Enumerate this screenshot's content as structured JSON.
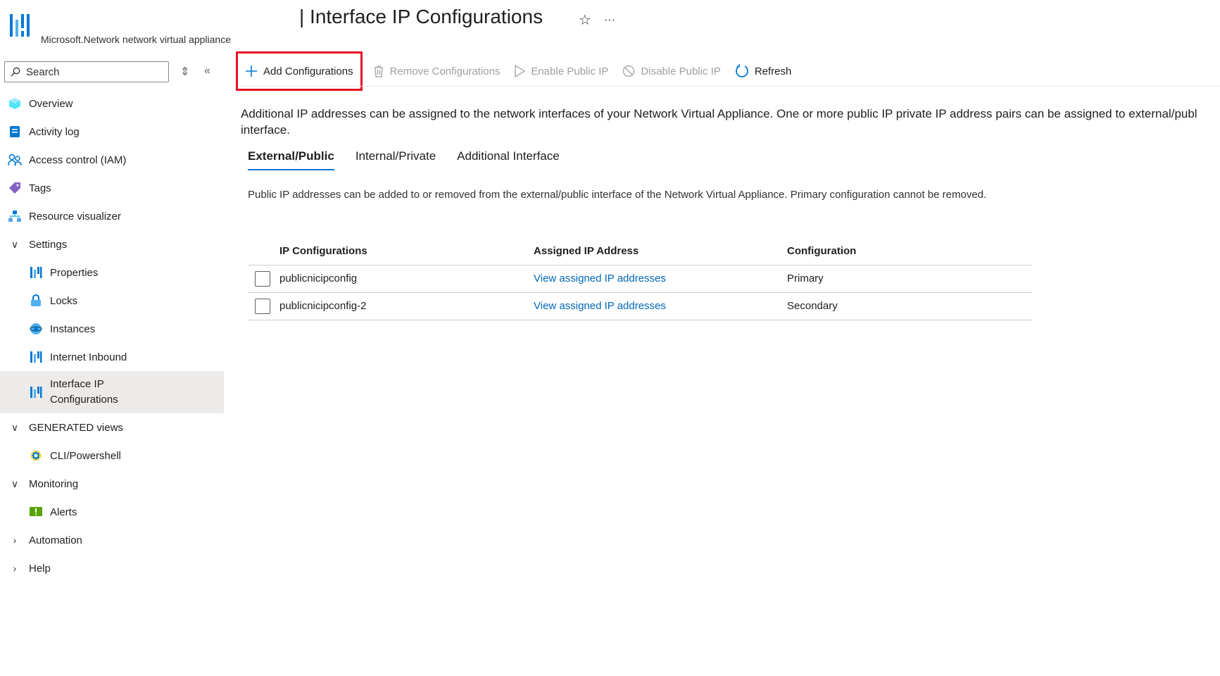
{
  "header": {
    "title": "| Interface IP Configurations",
    "resource_type": "Microsoft.Network network virtual appliance",
    "favorite_icon": "☆",
    "more_icon": "···"
  },
  "sidebar": {
    "search_placeholder": "Search",
    "items": [
      {
        "label": "Overview"
      },
      {
        "label": "Activity log"
      },
      {
        "label": "Access control (IAM)"
      },
      {
        "label": "Tags"
      },
      {
        "label": "Resource visualizer"
      },
      {
        "label": "Settings"
      },
      {
        "label": "Properties"
      },
      {
        "label": "Locks"
      },
      {
        "label": "Instances"
      },
      {
        "label": "Internet Inbound"
      },
      {
        "label": "Interface IP Configurations"
      },
      {
        "label": "GENERATED views"
      },
      {
        "label": "CLI/Powershell"
      },
      {
        "label": "Monitoring"
      },
      {
        "label": "Alerts"
      },
      {
        "label": "Automation"
      },
      {
        "label": "Help"
      }
    ]
  },
  "toolbar": {
    "add": "Add Configurations",
    "remove": "Remove Configurations",
    "enable": "Enable Public IP",
    "disable": "Disable Public IP",
    "refresh": "Refresh"
  },
  "main": {
    "description": "Additional IP addresses can be assigned to the network interfaces of your Network Virtual Appliance. One or more public IP private IP address pairs can be assigned to external/publ interface.",
    "tabs": [
      {
        "label": "External/Public"
      },
      {
        "label": "Internal/Private"
      },
      {
        "label": "Additional Interface"
      }
    ],
    "sub_description": "Public IP addresses can be added to or removed from the external/public interface of the Network Virtual Appliance. Primary configuration cannot be removed.",
    "table": {
      "headers": [
        "IP Configurations",
        "Assigned IP Address",
        "Configuration"
      ],
      "rows": [
        {
          "name": "publicnicipconfig",
          "assigned": "View assigned IP addresses",
          "config": "Primary"
        },
        {
          "name": "publicnicipconfig-2",
          "assigned": "View assigned IP addresses",
          "config": "Secondary"
        }
      ]
    }
  },
  "colors": {
    "accent": "#0078d4",
    "link": "#0067b8",
    "highlight": "#e81123",
    "selected_bg": "#edebe9"
  }
}
